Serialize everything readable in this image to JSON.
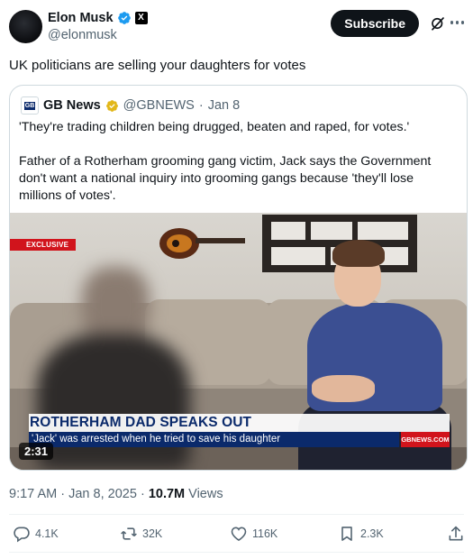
{
  "author": {
    "name": "Elon Musk",
    "handle": "@elonmusk",
    "x_badge": "X"
  },
  "header": {
    "subscribe_label": "Subscribe"
  },
  "tweet": {
    "text": "UK politicians are selling your daughters for votes"
  },
  "quote": {
    "logo_text": "GB",
    "name": "GB News",
    "handle": "@GBNEWS",
    "dot": "·",
    "date": "Jan 8",
    "paragraph1": "'They're trading children being drugged, beaten and raped, for votes.'",
    "paragraph2": "Father of a Rotherham grooming gang victim, Jack says the Government don't want a national inquiry into grooming gangs because 'they'll lose millions of votes'."
  },
  "video": {
    "exclusive_label": "EXCLUSIVE",
    "headline": "ROTHERHAM DAD SPEAKS OUT",
    "subheadline": "'Jack' was arrested when he tried to save his daughter",
    "channel_tag": "GBNEWS.COM",
    "duration": "2:31"
  },
  "meta": {
    "time": "9:17 AM",
    "sep": "·",
    "date": "Jan 8, 2025",
    "views_count": "10.7M",
    "views_label": "Views"
  },
  "actions": {
    "replies": "4.1K",
    "reposts": "32K",
    "likes": "116K",
    "bookmarks": "2.3K"
  },
  "colors": {
    "verified_blue": "#1d9bf0",
    "text_primary": "#0f1419",
    "text_secondary": "#536471",
    "gb_red": "#d1141c",
    "gb_navy": "#0b2a6b"
  },
  "icons": [
    "verified-badge-icon",
    "x-badge-icon",
    "grok-icon",
    "more-icon",
    "reply-icon",
    "repost-icon",
    "like-icon",
    "bookmark-icon",
    "share-icon"
  ]
}
